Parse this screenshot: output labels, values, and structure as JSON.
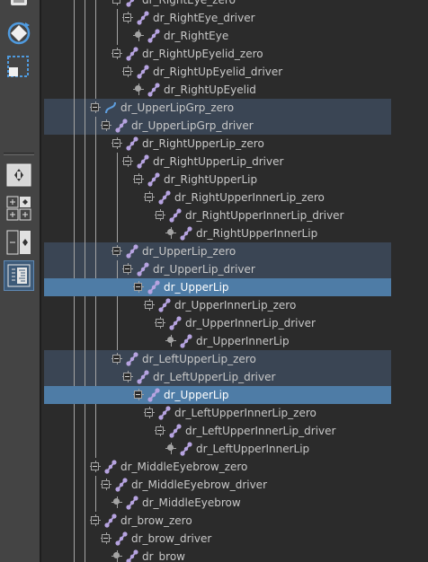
{
  "toolbar": {
    "buttons": [
      {
        "name": "move-tool-icon",
        "active": false
      },
      {
        "name": "rotate-tool-icon",
        "active": false
      },
      {
        "name": "scale-tool-icon",
        "active": false
      },
      {
        "name": "single-view-layout-icon",
        "active": false
      },
      {
        "name": "four-view-layout-icon",
        "active": false
      },
      {
        "name": "two-view-layout-icon",
        "active": false
      },
      {
        "name": "outliner-layout-icon",
        "active": true
      }
    ]
  },
  "outliner": {
    "highlight_color": "#3a4554",
    "selected_color": "#4e7ca6",
    "text_color": "#c8c8c8",
    "icon_color": "#b6a3e0",
    "rows": [
      {
        "depth": 5,
        "connector": "box",
        "icon": "joint",
        "label": "dr_RightEye_zero",
        "selected": false,
        "highlighted": false
      },
      {
        "depth": 6,
        "connector": "box",
        "icon": "joint",
        "label": "dr_RightEye_driver",
        "selected": false,
        "highlighted": false
      },
      {
        "depth": 7,
        "connector": "dot",
        "icon": "joint",
        "label": "dr_RightEye",
        "selected": false,
        "highlighted": false
      },
      {
        "depth": 5,
        "connector": "box",
        "icon": "joint",
        "label": "dr_RightUpEyelid_zero",
        "selected": false,
        "highlighted": false
      },
      {
        "depth": 6,
        "connector": "box",
        "icon": "joint",
        "label": "dr_RightUpEyelid_driver",
        "selected": false,
        "highlighted": false
      },
      {
        "depth": 7,
        "connector": "dot",
        "icon": "joint",
        "label": "dr_RightUpEyelid",
        "selected": false,
        "highlighted": false
      },
      {
        "depth": 3,
        "connector": "box",
        "icon": "curve",
        "label": "dr_UpperLipGrp_zero",
        "selected": false,
        "highlighted": true
      },
      {
        "depth": 4,
        "connector": "box",
        "icon": "joint",
        "label": "dr_UpperLipGrp_driver",
        "selected": false,
        "highlighted": true
      },
      {
        "depth": 5,
        "connector": "box",
        "icon": "joint",
        "label": "dr_RightUpperLip_zero",
        "selected": false,
        "highlighted": false
      },
      {
        "depth": 6,
        "connector": "box",
        "icon": "joint",
        "label": "dr_RightUpperLip_driver",
        "selected": false,
        "highlighted": false
      },
      {
        "depth": 7,
        "connector": "box",
        "icon": "joint",
        "label": "dr_RightUpperLip",
        "selected": false,
        "highlighted": false
      },
      {
        "depth": 8,
        "connector": "box",
        "icon": "joint",
        "label": "dr_RightUpperInnerLip_zero",
        "selected": false,
        "highlighted": false
      },
      {
        "depth": 9,
        "connector": "box",
        "icon": "joint",
        "label": "dr_RightUpperInnerLip_driver",
        "selected": false,
        "highlighted": false
      },
      {
        "depth": 10,
        "connector": "dot",
        "icon": "joint",
        "label": "dr_RightUpperInnerLip",
        "selected": false,
        "highlighted": false
      },
      {
        "depth": 5,
        "connector": "box",
        "icon": "joint",
        "label": "dr_UpperLip_zero",
        "selected": false,
        "highlighted": true
      },
      {
        "depth": 6,
        "connector": "box",
        "icon": "joint",
        "label": "dr_UpperLip_driver",
        "selected": false,
        "highlighted": true
      },
      {
        "depth": 7,
        "connector": "box",
        "icon": "joint",
        "label": "dr_UpperLip",
        "selected": true,
        "highlighted": false
      },
      {
        "depth": 8,
        "connector": "box",
        "icon": "joint",
        "label": "dr_UpperInnerLip_zero",
        "selected": false,
        "highlighted": false
      },
      {
        "depth": 9,
        "connector": "box",
        "icon": "joint",
        "label": "dr_UpperInnerLip_driver",
        "selected": false,
        "highlighted": false
      },
      {
        "depth": 10,
        "connector": "dot",
        "icon": "joint",
        "label": "dr_UpperInnerLip",
        "selected": false,
        "highlighted": false
      },
      {
        "depth": 5,
        "connector": "box",
        "icon": "joint",
        "label": "dr_LeftUpperLip_zero",
        "selected": false,
        "highlighted": true
      },
      {
        "depth": 6,
        "connector": "box",
        "icon": "joint",
        "label": "dr_LeftUpperLip_driver",
        "selected": false,
        "highlighted": true
      },
      {
        "depth": 7,
        "connector": "box",
        "icon": "joint",
        "label": "dr_UpperLip",
        "selected": true,
        "highlighted": false
      },
      {
        "depth": 8,
        "connector": "box",
        "icon": "joint",
        "label": "dr_LeftUpperInnerLip_zero",
        "selected": false,
        "highlighted": false
      },
      {
        "depth": 9,
        "connector": "box",
        "icon": "joint",
        "label": "dr_LeftUpperInnerLip_driver",
        "selected": false,
        "highlighted": false
      },
      {
        "depth": 10,
        "connector": "dot",
        "icon": "joint",
        "label": "dr_LeftUpperInnerLip",
        "selected": false,
        "highlighted": false
      },
      {
        "depth": 3,
        "connector": "box",
        "icon": "joint",
        "label": "dr_MiddleEyebrow_zero",
        "selected": false,
        "highlighted": false
      },
      {
        "depth": 4,
        "connector": "box",
        "icon": "joint",
        "label": "dr_MiddleEyebrow_driver",
        "selected": false,
        "highlighted": false
      },
      {
        "depth": 5,
        "connector": "dot",
        "icon": "joint",
        "label": "dr_MiddleEyebrow",
        "selected": false,
        "highlighted": false
      },
      {
        "depth": 3,
        "connector": "box",
        "icon": "joint",
        "label": "dr_brow_zero",
        "selected": false,
        "highlighted": false
      },
      {
        "depth": 4,
        "connector": "box",
        "icon": "joint",
        "label": "dr_brow_driver",
        "selected": false,
        "highlighted": false
      },
      {
        "depth": 5,
        "connector": "dot",
        "icon": "joint",
        "label": "dr_brow",
        "selected": false,
        "highlighted": false
      }
    ]
  }
}
